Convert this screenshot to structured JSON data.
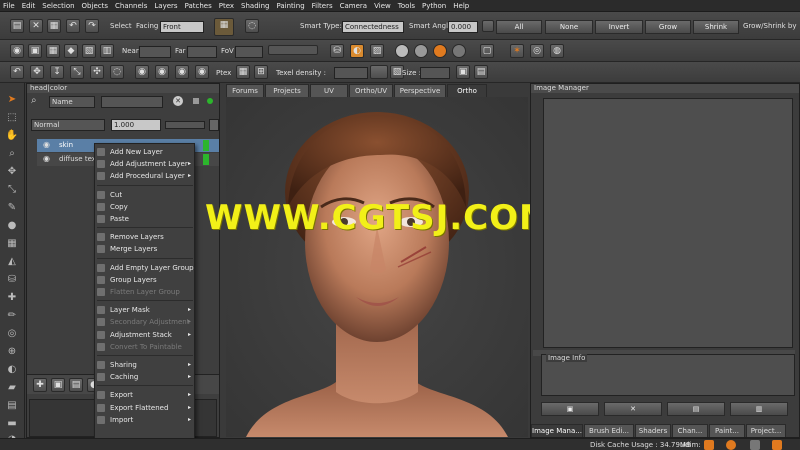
{
  "menubar": [
    "File",
    "Edit",
    "Selection",
    "Objects",
    "Channels",
    "Layers",
    "Patches",
    "Ptex",
    "Shading",
    "Painting",
    "Filters",
    "Camera",
    "View",
    "Tools",
    "Python",
    "Help"
  ],
  "toolbar1": {
    "select_label": "Select",
    "facing_label": "Facing",
    "facing_value": "Front",
    "smart_type_label": "Smart Type:",
    "smart_type_value": "Connectedness",
    "smart_angle_label": "Smart Angle",
    "smart_angle_value": "0.000",
    "all_label": "All",
    "none_label": "None",
    "invert_label": "Invert",
    "grow_label": "Grow",
    "shrink_label": "Shrink",
    "grow_shrink_label": "Grow/Shrink by"
  },
  "toolbar2": {
    "near_label": "Near",
    "far_label": "Far",
    "fov_label": "FoV"
  },
  "toolbar3": {
    "ptex_label": "Ptex",
    "texel_density_label": "Texel density :",
    "size_label": "Size :"
  },
  "layers_panel": {
    "title": "head|color",
    "filter_mode": "Name",
    "blend_mode": "Normal",
    "opacity": "1.000",
    "layers": [
      "skin",
      "diffuse text"
    ]
  },
  "context_menu": {
    "items": [
      {
        "label": "Add New Layer",
        "arrow": "",
        "disabled": false
      },
      {
        "label": "Add Adjustment Layer",
        "arrow": "▸",
        "disabled": false
      },
      {
        "label": "Add Procedural Layer",
        "arrow": "▸",
        "disabled": false
      },
      {
        "label": "Cut",
        "arrow": "",
        "disabled": false
      },
      {
        "label": "Copy",
        "arrow": "",
        "disabled": false
      },
      {
        "label": "Paste",
        "arrow": "",
        "disabled": false
      },
      {
        "label": "Remove Layers",
        "arrow": "",
        "disabled": false
      },
      {
        "label": "Merge Layers",
        "arrow": "",
        "disabled": false
      },
      {
        "label": "Add Empty Layer Group",
        "arrow": "",
        "disabled": false
      },
      {
        "label": "Group Layers",
        "arrow": "",
        "disabled": false
      },
      {
        "label": "Flatten Layer Group",
        "arrow": "",
        "disabled": true
      },
      {
        "label": "Layer Mask",
        "arrow": "▸",
        "disabled": false
      },
      {
        "label": "Secondary Adjustment",
        "arrow": "▸",
        "disabled": true
      },
      {
        "label": "Adjustment Stack",
        "arrow": "▸",
        "disabled": false
      },
      {
        "label": "Convert To Paintable",
        "arrow": "",
        "disabled": true
      },
      {
        "label": "Sharing",
        "arrow": "▸",
        "disabled": false
      },
      {
        "label": "Caching",
        "arrow": "▸",
        "disabled": false
      },
      {
        "label": "Export",
        "arrow": "▸",
        "disabled": false
      },
      {
        "label": "Export Flattened",
        "arrow": "▸",
        "disabled": false
      },
      {
        "label": "Import",
        "arrow": "▸",
        "disabled": false
      }
    ]
  },
  "viewport_tabs": [
    "Forums",
    "Projects",
    "UV",
    "Ortho/UV",
    "Perspective",
    "Ortho"
  ],
  "watermark": "WWW.CGTSJ.COM",
  "image_manager": {
    "title": "Image Manager",
    "info_label": "Image Info",
    "bottom_tabs": [
      "Image Mana...",
      "Brush Edi...",
      "Shaders",
      "Chan...",
      "Paint...",
      "Project..."
    ]
  },
  "status": {
    "cache_label": "Disk Cache Usage : 34.79MB",
    "udim_label": "Udim:"
  },
  "colors": {
    "accent_orange": "#e07a1f",
    "watermark_yellow": "#f2f018",
    "layer_selected": "#5a7fa6"
  }
}
